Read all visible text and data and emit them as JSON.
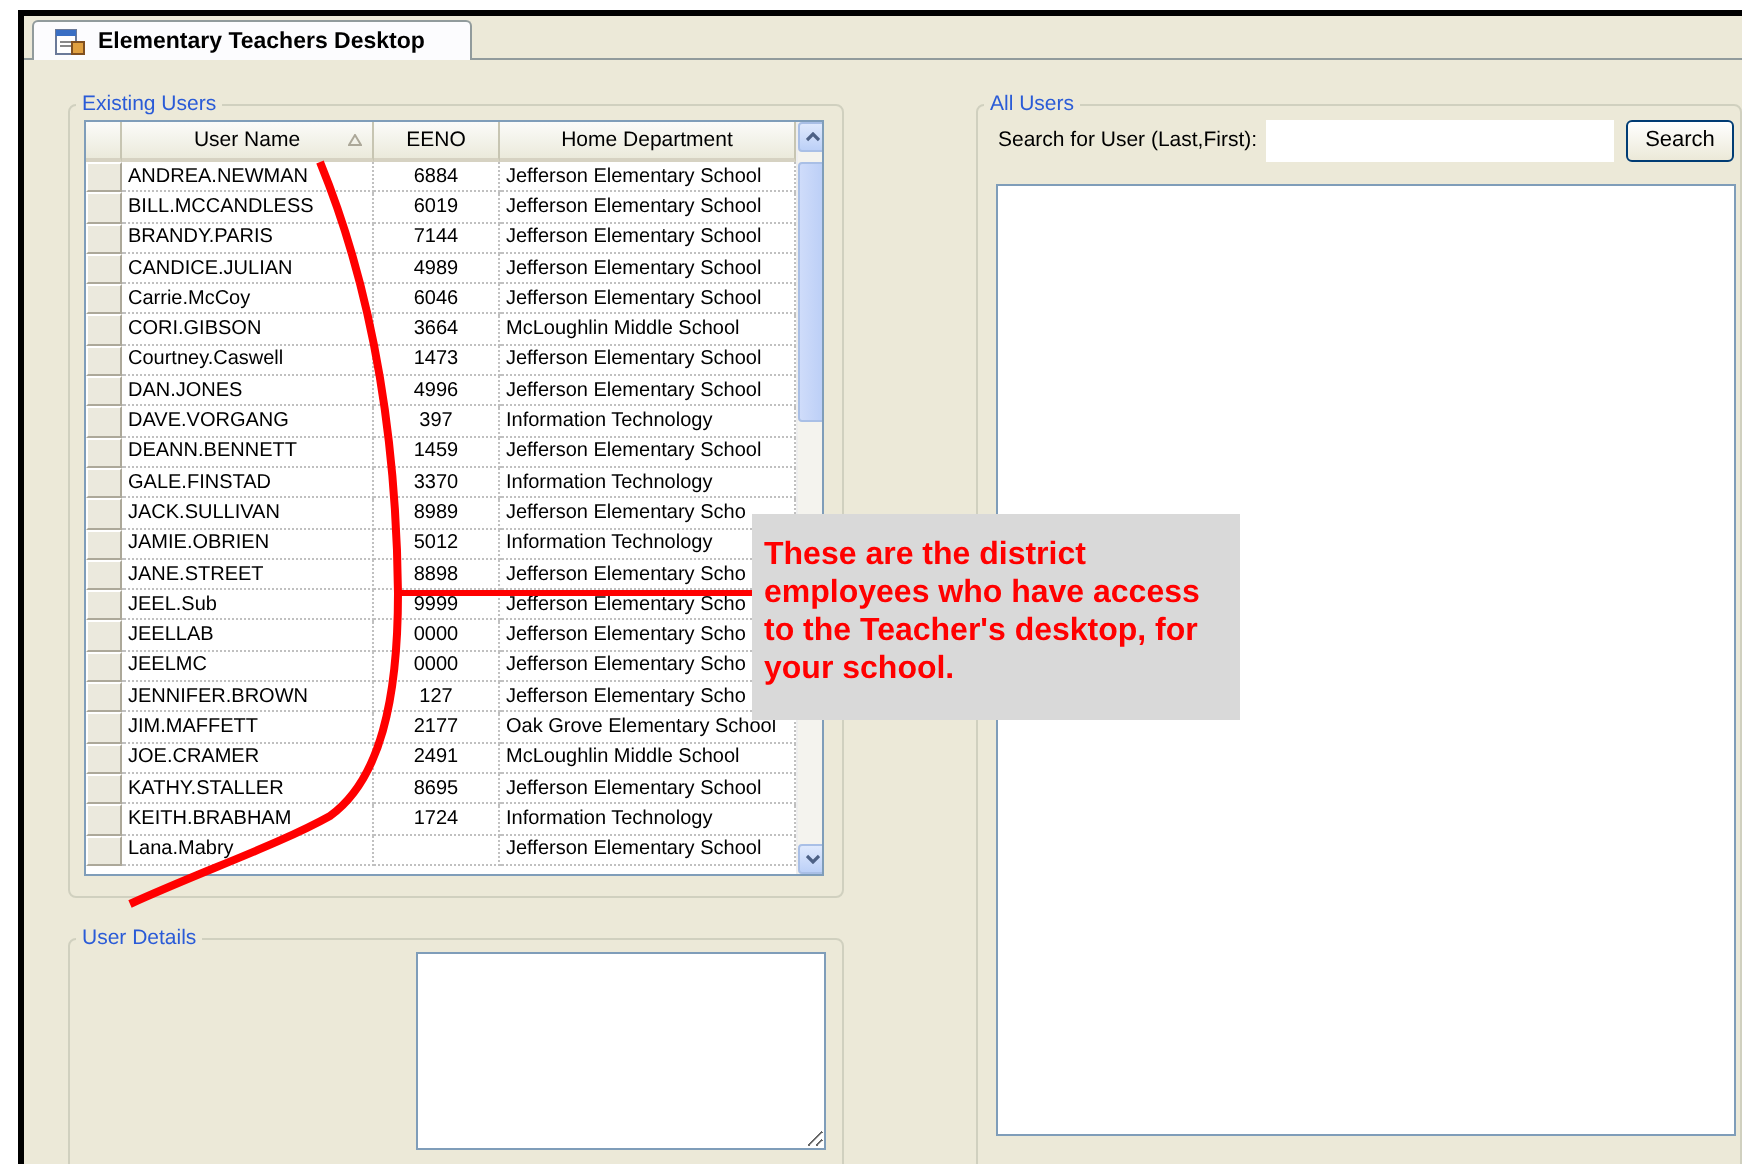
{
  "tab": {
    "title": "Elementary Teachers Desktop"
  },
  "existing_users": {
    "legend": "Existing Users",
    "columns": [
      {
        "label": "User Name",
        "sorted": true
      },
      {
        "label": "EENO",
        "sorted": false
      },
      {
        "label": "Home Department",
        "sorted": false
      }
    ],
    "rows": [
      {
        "user_name": "ANDREA.NEWMAN",
        "eeno": "6884",
        "department": "Jefferson Elementary School"
      },
      {
        "user_name": "BILL.MCCANDLESS",
        "eeno": "6019",
        "department": "Jefferson Elementary School"
      },
      {
        "user_name": "BRANDY.PARIS",
        "eeno": "7144",
        "department": "Jefferson Elementary School"
      },
      {
        "user_name": "CANDICE.JULIAN",
        "eeno": "4989",
        "department": "Jefferson Elementary School"
      },
      {
        "user_name": "Carrie.McCoy",
        "eeno": "6046",
        "department": "Jefferson Elementary School"
      },
      {
        "user_name": "CORI.GIBSON",
        "eeno": "3664",
        "department": "McLoughlin Middle School"
      },
      {
        "user_name": "Courtney.Caswell",
        "eeno": "1473",
        "department": "Jefferson Elementary School"
      },
      {
        "user_name": "DAN.JONES",
        "eeno": "4996",
        "department": "Jefferson Elementary School"
      },
      {
        "user_name": "DAVE.VORGANG",
        "eeno": "397",
        "department": "Information Technology"
      },
      {
        "user_name": "DEANN.BENNETT",
        "eeno": "1459",
        "department": "Jefferson Elementary School"
      },
      {
        "user_name": "GALE.FINSTAD",
        "eeno": "3370",
        "department": "Information Technology"
      },
      {
        "user_name": "JACK.SULLIVAN",
        "eeno": "8989",
        "department": "Jefferson Elementary Scho"
      },
      {
        "user_name": "JAMIE.OBRIEN",
        "eeno": "5012",
        "department": "Information Technology"
      },
      {
        "user_name": "JANE.STREET",
        "eeno": "8898",
        "department": "Jefferson Elementary Scho"
      },
      {
        "user_name": "JEEL.Sub",
        "eeno": "9999",
        "department": "Jefferson Elementary Scho"
      },
      {
        "user_name": "JEELLAB",
        "eeno": "0000",
        "department": "Jefferson Elementary Scho"
      },
      {
        "user_name": "JEELMC",
        "eeno": "0000",
        "department": "Jefferson Elementary Scho"
      },
      {
        "user_name": "JENNIFER.BROWN",
        "eeno": "127",
        "department": "Jefferson Elementary Scho"
      },
      {
        "user_name": "JIM.MAFFETT",
        "eeno": "2177",
        "department": "Oak Grove Elementary School"
      },
      {
        "user_name": "JOE.CRAMER",
        "eeno": "2491",
        "department": "McLoughlin Middle School"
      },
      {
        "user_name": "KATHY.STALLER",
        "eeno": "8695",
        "department": "Jefferson Elementary School"
      },
      {
        "user_name": "KEITH.BRABHAM",
        "eeno": "1724",
        "department": "Information Technology"
      },
      {
        "user_name": "Lana.Mabry",
        "department": "Jefferson Elementary School"
      }
    ]
  },
  "user_details": {
    "legend": "User Details"
  },
  "all_users": {
    "legend": "All Users",
    "search_label": "Search for User (Last,First):",
    "search_button": "Search"
  },
  "callout": {
    "text": "These are the district employees who have access to the Teacher's desktop, for your school."
  }
}
